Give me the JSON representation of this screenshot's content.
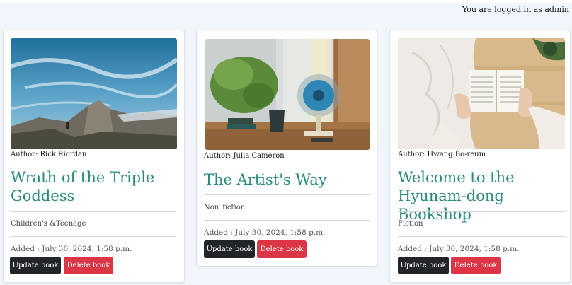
{
  "header": {
    "login_status": "You are logged in as admin"
  },
  "books": [
    {
      "author": "Author: Rick Riordan",
      "title": "Wrath of the Triple Goddess",
      "genre": "Children's &Teenage",
      "added": "Added : July 30, 2024, 1:58 p.m.",
      "update_label": "Update book",
      "delete_label": "Delete book",
      "image": "mountain-landscape-image"
    },
    {
      "author": "Author: Julia Cameron",
      "title": "The Artist's Way",
      "genre": "Non_fiction",
      "added": "Added : July 30, 2024, 1:58 p.m.",
      "update_label": "Update book",
      "delete_label": "Delete book",
      "image": "window-fan-plant-image"
    },
    {
      "author": "Author: Hwang Bo-reum",
      "title": "Welcome to the Hyunam-dong Bookshop",
      "genre": "Fiction",
      "added": "Added : July 30, 2024, 1:58 p.m.",
      "update_label": "Update book",
      "delete_label": "Delete book",
      "image": "reading-book-image"
    }
  ],
  "colors": {
    "title": "#2b8a7e",
    "update_button": "#212529",
    "delete_button": "#dc3545",
    "background": "#f0f6fc"
  }
}
